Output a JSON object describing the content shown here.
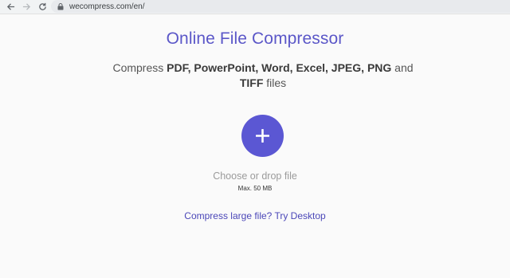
{
  "browser": {
    "url": "wecompress.com/en/",
    "back_icon": "back-arrow-icon",
    "forward_icon": "forward-arrow-icon",
    "reload_icon": "reload-icon",
    "lock_icon": "lock-icon"
  },
  "page": {
    "title": "Online File Compressor",
    "subtitle_parts": {
      "lead": "Compress ",
      "formats1": "PDF, PowerPoint, Word, Excel, JPEG, PNG",
      "and": " and ",
      "formats2": "TIFF",
      "tail": " files"
    },
    "upload_icon": "plus-icon",
    "choose_label": "Choose or drop file",
    "max_label": "Max. 50 MB",
    "desktop_link": "Compress large file? Try Desktop"
  },
  "colors": {
    "accent": "#5b57d3",
    "title": "#5b57c8",
    "link": "#4b47b8"
  }
}
